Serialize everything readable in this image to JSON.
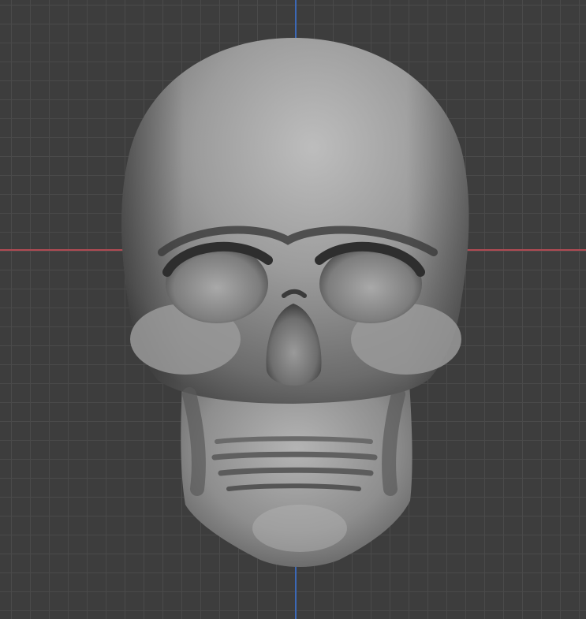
{
  "viewport": {
    "background_color": "#3d3d3d",
    "grid_color": "#4a4a4a",
    "grid_visible": true,
    "x_axis_color": "#b04a53",
    "y_axis_color": "#3c68b5"
  },
  "object": {
    "icon": "skull-icon",
    "material_color": "#9a9a9a"
  }
}
